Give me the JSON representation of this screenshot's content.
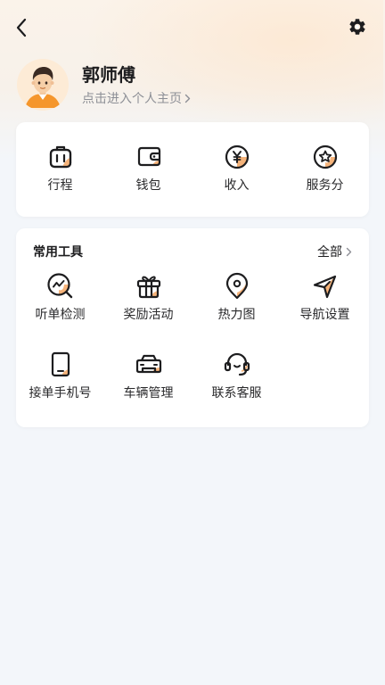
{
  "header": {
    "back_icon": "chevron-left-icon",
    "settings_icon": "gear-icon"
  },
  "profile": {
    "name": "郭师傅",
    "link_text": "点击进入个人主页",
    "avatar": "driver-avatar"
  },
  "stats": [
    {
      "label": "行程",
      "icon": "luggage-icon"
    },
    {
      "label": "钱包",
      "icon": "wallet-icon"
    },
    {
      "label": "收入",
      "icon": "yuan-coin-icon"
    },
    {
      "label": "服务分",
      "icon": "star-badge-icon"
    }
  ],
  "tools": {
    "title": "常用工具",
    "all_label": "全部",
    "items": [
      {
        "label": "听单检测",
        "icon": "order-check-icon"
      },
      {
        "label": "奖励活动",
        "icon": "gift-icon"
      },
      {
        "label": "热力图",
        "icon": "map-pin-icon"
      },
      {
        "label": "导航设置",
        "icon": "navigation-icon"
      },
      {
        "label": "接单手机号",
        "icon": "phone-icon"
      },
      {
        "label": "车辆管理",
        "icon": "car-icon"
      },
      {
        "label": "联系客服",
        "icon": "headset-icon"
      }
    ]
  },
  "colors": {
    "accent": "#f5b37a",
    "ink": "#1d1d1f",
    "background": "#f3f6fa"
  }
}
